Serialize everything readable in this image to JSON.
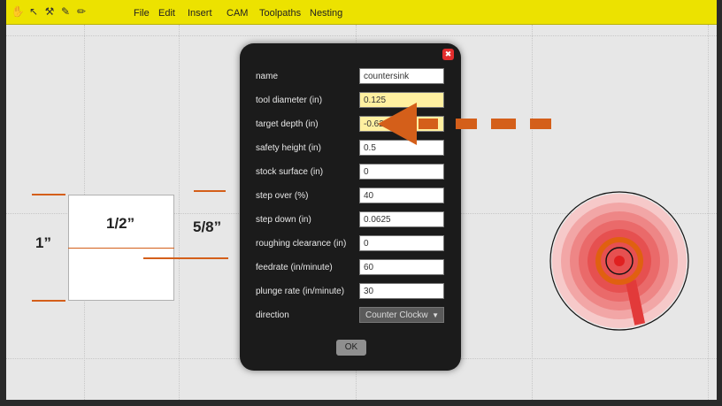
{
  "toolbar": {
    "tools": [
      {
        "icon": "hand-tool-icon",
        "glyph": "✋"
      },
      {
        "icon": "pointer-tool-icon",
        "glyph": "↖"
      },
      {
        "icon": "wrench-tool-icon",
        "glyph": "⚒"
      },
      {
        "icon": "pencil-tool-icon",
        "glyph": "✎"
      },
      {
        "icon": "pen-tool-icon",
        "glyph": "✏"
      }
    ],
    "menus": [
      "File",
      "Edit",
      "Insert",
      "CAM",
      "Toolpaths",
      "Nesting"
    ]
  },
  "drawing": {
    "dim_top": "1/2”",
    "dim_left": "1”",
    "dim_right": "5/8”"
  },
  "dialog": {
    "fields": [
      {
        "label": "name",
        "value": "countersink"
      },
      {
        "label": "tool diameter (in)",
        "value": "0.125"
      },
      {
        "label": "target depth (in)",
        "value": "-0.625"
      },
      {
        "label": "safety height (in)",
        "value": "0.5"
      },
      {
        "label": "stock surface (in)",
        "value": "0"
      },
      {
        "label": "step over (%)",
        "value": "40"
      },
      {
        "label": "step down (in)",
        "value": "0.0625"
      },
      {
        "label": "roughing clearance (in)",
        "value": "0"
      },
      {
        "label": "feedrate (in/minute)",
        "value": "60"
      },
      {
        "label": "plunge rate (in/minute)",
        "value": "30"
      }
    ],
    "direction_label": "direction",
    "direction_value": "Counter Clockw",
    "ok_label": "OK",
    "close_glyph": "✖"
  },
  "colors": {
    "menubar": "#ece200",
    "accent_orange": "#d45f1a",
    "highlight_input": "#fff0a0"
  }
}
